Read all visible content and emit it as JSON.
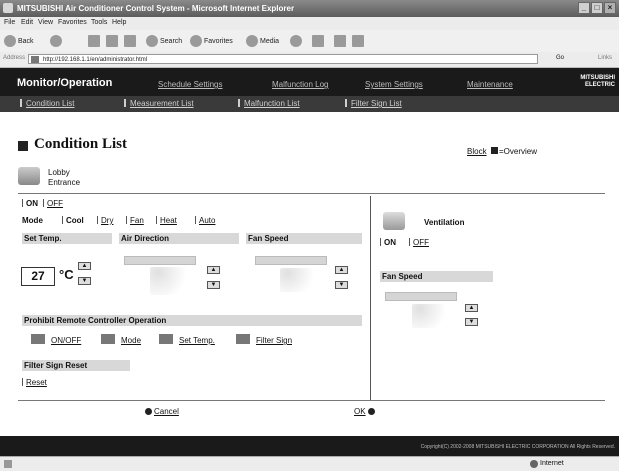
{
  "window": {
    "title": "MITSUBISHI Air Conditioner Control System - Microsoft Internet Explorer"
  },
  "menubar": [
    "File",
    "Edit",
    "View",
    "Favorites",
    "Tools",
    "Help"
  ],
  "toolbar": {
    "back": "Back",
    "search": "Search",
    "favorites": "Favorites",
    "media": "Media"
  },
  "address": {
    "label": "Address",
    "url": "http://192.168.1.1/en/administrator.html",
    "go": "Go",
    "links": "Links"
  },
  "header": {
    "main_title": "Monitor/Operation",
    "nav": [
      "Schedule Settings",
      "Malfunction Log",
      "System Settings",
      "Maintenance"
    ],
    "subnav": [
      "Condition List",
      "Measurement List",
      "Malfunction List",
      "Filter Sign List"
    ],
    "logo": "MITSUBISHI ELECTRIC"
  },
  "page": {
    "title": "Condition List",
    "block": "Block",
    "overview": "Overview",
    "unit_name_1": "Lobby",
    "unit_name_2": "Entrance"
  },
  "controls": {
    "on": "ON",
    "off": "OFF",
    "mode_label": "Mode",
    "modes": [
      "Cool",
      "Dry",
      "Fan",
      "Heat",
      "Auto"
    ],
    "set_temp_label": "Set Temp.",
    "air_direction_label": "Air Direction",
    "fan_speed_label": "Fan Speed",
    "temp_value": "27",
    "temp_unit": "°C"
  },
  "prohibit": {
    "label": "Prohibit Remote Controller Operation",
    "items": [
      "ON/OFF",
      "Mode",
      "Set Temp.",
      "Filter Sign"
    ]
  },
  "filter": {
    "label": "Filter Sign Reset",
    "reset": "Reset"
  },
  "ventilation": {
    "label": "Ventilation",
    "on": "ON",
    "off": "OFF",
    "fan_speed_label": "Fan Speed"
  },
  "actions": {
    "cancel": "Cancel",
    "ok": "OK"
  },
  "footer": {
    "copyright": "Copyright(C) 2002-2008 MITSUBISHI ELECTRIC CORPORATION All Rights Reserved."
  },
  "statusbar": {
    "zone": "Internet"
  }
}
